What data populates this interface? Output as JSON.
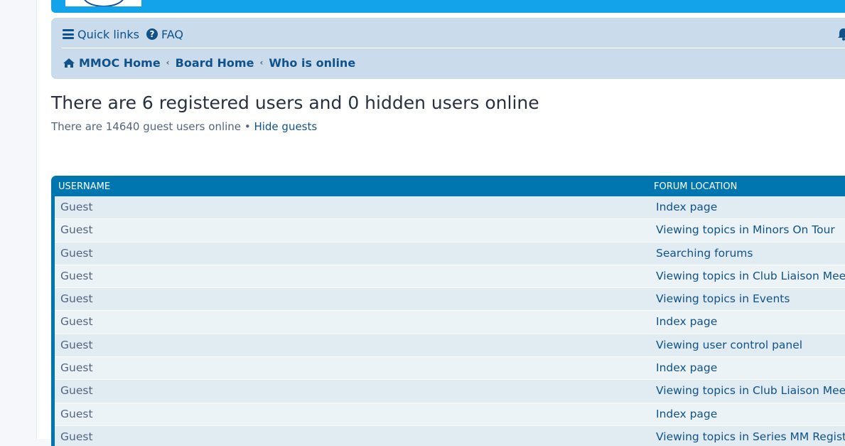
{
  "nav": {
    "quick_links": "Quick links",
    "faq": "FAQ"
  },
  "breadcrumb": [
    {
      "label": "MMOC Home"
    },
    {
      "label": "Board Home"
    },
    {
      "label": "Who is online"
    }
  ],
  "page": {
    "title": "There are 6 registered users and 0 hidden users online",
    "guest_text": "There are 14640 guest users online",
    "separator": "•",
    "hide_guests": "Hide guests"
  },
  "table": {
    "headers": {
      "username": "USERNAME",
      "forum_location": "FORUM LOCATION"
    },
    "rows": [
      {
        "username": "Guest",
        "location": "Index page"
      },
      {
        "username": "Guest",
        "location": "Viewing topics in Minors On Tour"
      },
      {
        "username": "Guest",
        "location": "Searching forums"
      },
      {
        "username": "Guest",
        "location": "Viewing topics in Club Liaison Meetings"
      },
      {
        "username": "Guest",
        "location": "Viewing topics in Events"
      },
      {
        "username": "Guest",
        "location": "Index page"
      },
      {
        "username": "Guest",
        "location": "Viewing user control panel"
      },
      {
        "username": "Guest",
        "location": "Index page"
      },
      {
        "username": "Guest",
        "location": "Viewing topics in Club Liaison Meetings"
      },
      {
        "username": "Guest",
        "location": "Index page"
      },
      {
        "username": "Guest",
        "location": "Viewing topics in Series MM Registers"
      }
    ]
  },
  "colors": {
    "header_blue": "#12a3eb",
    "nav_bg": "#cadceb",
    "link": "#105289",
    "table_head": "#0076b1",
    "row_odd": "#e1ebf2",
    "row_even": "#ecf3f7"
  },
  "icons": [
    "bars-icon",
    "question-circle-icon",
    "home-icon",
    "chevron-left-icon",
    "bell-icon"
  ]
}
